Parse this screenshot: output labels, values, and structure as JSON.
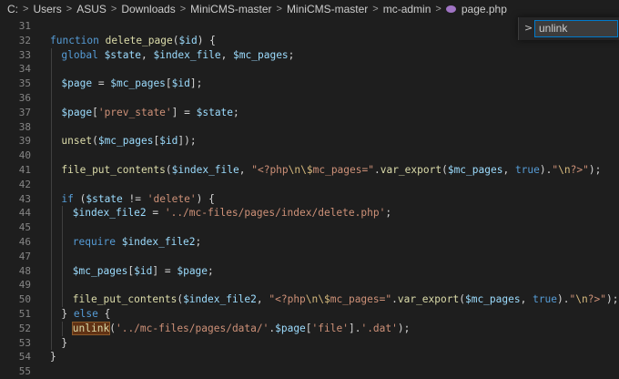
{
  "breadcrumb": {
    "items": [
      "C:",
      "Users",
      "ASUS",
      "Downloads",
      "MiniCMS-master",
      "MiniCMS-master",
      "mc-admin"
    ],
    "file": "page.php",
    "separator": ">"
  },
  "find_widget": {
    "toggle": ">",
    "value": "unlink"
  },
  "editor": {
    "lines": [
      {
        "n": "31",
        "indent": 0,
        "t": []
      },
      {
        "n": "32",
        "indent": 0,
        "t": [
          [
            "kw",
            "function"
          ],
          [
            "p",
            " "
          ],
          [
            "fn",
            "delete_page"
          ],
          [
            "p",
            "("
          ],
          [
            "var",
            "$id"
          ],
          [
            "p",
            ") {"
          ]
        ]
      },
      {
        "n": "33",
        "indent": 1,
        "t": [
          [
            "kw",
            "global"
          ],
          [
            "p",
            " "
          ],
          [
            "var",
            "$state"
          ],
          [
            "p",
            ", "
          ],
          [
            "var",
            "$index_file"
          ],
          [
            "p",
            ", "
          ],
          [
            "var",
            "$mc_pages"
          ],
          [
            "p",
            ";"
          ]
        ]
      },
      {
        "n": "34",
        "indent": 1,
        "t": []
      },
      {
        "n": "35",
        "indent": 1,
        "t": [
          [
            "var",
            "$page"
          ],
          [
            "p",
            " = "
          ],
          [
            "var",
            "$mc_pages"
          ],
          [
            "p",
            "["
          ],
          [
            "var",
            "$id"
          ],
          [
            "p",
            "];"
          ]
        ]
      },
      {
        "n": "36",
        "indent": 1,
        "t": []
      },
      {
        "n": "37",
        "indent": 1,
        "t": [
          [
            "var",
            "$page"
          ],
          [
            "p",
            "["
          ],
          [
            "str",
            "'prev_state'"
          ],
          [
            "p",
            "] = "
          ],
          [
            "var",
            "$state"
          ],
          [
            "p",
            ";"
          ]
        ]
      },
      {
        "n": "38",
        "indent": 1,
        "t": []
      },
      {
        "n": "39",
        "indent": 1,
        "t": [
          [
            "fn",
            "unset"
          ],
          [
            "p",
            "("
          ],
          [
            "var",
            "$mc_pages"
          ],
          [
            "p",
            "["
          ],
          [
            "var",
            "$id"
          ],
          [
            "p",
            "]);"
          ]
        ]
      },
      {
        "n": "40",
        "indent": 1,
        "t": []
      },
      {
        "n": "41",
        "indent": 1,
        "t": [
          [
            "fn",
            "file_put_contents"
          ],
          [
            "p",
            "("
          ],
          [
            "var",
            "$index_file"
          ],
          [
            "p",
            ", "
          ],
          [
            "str",
            "\"<?php"
          ],
          [
            "esc",
            "\\n\\$"
          ],
          [
            "str",
            "mc_pages=\""
          ],
          [
            "p",
            "."
          ],
          [
            "fn",
            "var_export"
          ],
          [
            "p",
            "("
          ],
          [
            "var",
            "$mc_pages"
          ],
          [
            "p",
            ", "
          ],
          [
            "kw",
            "true"
          ],
          [
            "p",
            ")."
          ],
          [
            "str",
            "\""
          ],
          [
            "esc",
            "\\n"
          ],
          [
            "str",
            "?>\""
          ],
          [
            "p",
            ");"
          ]
        ]
      },
      {
        "n": "42",
        "indent": 1,
        "t": []
      },
      {
        "n": "43",
        "indent": 1,
        "t": [
          [
            "kw",
            "if"
          ],
          [
            "p",
            " ("
          ],
          [
            "var",
            "$state"
          ],
          [
            "p",
            " != "
          ],
          [
            "str",
            "'delete'"
          ],
          [
            "p",
            ") {"
          ]
        ]
      },
      {
        "n": "44",
        "indent": 2,
        "t": [
          [
            "var",
            "$index_file2"
          ],
          [
            "p",
            " = "
          ],
          [
            "str",
            "'../mc-files/pages/index/delete.php'"
          ],
          [
            "p",
            ";"
          ]
        ]
      },
      {
        "n": "45",
        "indent": 2,
        "t": []
      },
      {
        "n": "46",
        "indent": 2,
        "t": [
          [
            "kw",
            "require"
          ],
          [
            "p",
            " "
          ],
          [
            "var",
            "$index_file2"
          ],
          [
            "p",
            ";"
          ]
        ]
      },
      {
        "n": "47",
        "indent": 2,
        "t": []
      },
      {
        "n": "48",
        "indent": 2,
        "t": [
          [
            "var",
            "$mc_pages"
          ],
          [
            "p",
            "["
          ],
          [
            "var",
            "$id"
          ],
          [
            "p",
            "] = "
          ],
          [
            "var",
            "$page"
          ],
          [
            "p",
            ";"
          ]
        ]
      },
      {
        "n": "49",
        "indent": 2,
        "t": []
      },
      {
        "n": "50",
        "indent": 2,
        "t": [
          [
            "fn",
            "file_put_contents"
          ],
          [
            "p",
            "("
          ],
          [
            "var",
            "$index_file2"
          ],
          [
            "p",
            ", "
          ],
          [
            "str",
            "\"<?php"
          ],
          [
            "esc",
            "\\n\\$"
          ],
          [
            "str",
            "mc_pages=\""
          ],
          [
            "p",
            "."
          ],
          [
            "fn",
            "var_export"
          ],
          [
            "p",
            "("
          ],
          [
            "var",
            "$mc_pages"
          ],
          [
            "p",
            ", "
          ],
          [
            "kw",
            "true"
          ],
          [
            "p",
            ")."
          ],
          [
            "str",
            "\""
          ],
          [
            "esc",
            "\\n"
          ],
          [
            "str",
            "?>\""
          ],
          [
            "p",
            ");"
          ]
        ]
      },
      {
        "n": "51",
        "indent": 1,
        "t": [
          [
            "p",
            "} "
          ],
          [
            "kw",
            "else"
          ],
          [
            "p",
            " {"
          ]
        ]
      },
      {
        "n": "52",
        "indent": 2,
        "t": [
          [
            "hl",
            "unlink"
          ],
          [
            "p",
            "("
          ],
          [
            "str",
            "'../mc-files/pages/data/'"
          ],
          [
            "p",
            "."
          ],
          [
            "var",
            "$page"
          ],
          [
            "p",
            "["
          ],
          [
            "str",
            "'file'"
          ],
          [
            "p",
            "]."
          ],
          [
            "str",
            "'.dat'"
          ],
          [
            "p",
            ");"
          ]
        ]
      },
      {
        "n": "53",
        "indent": 1,
        "t": [
          [
            "p",
            "}"
          ]
        ]
      },
      {
        "n": "54",
        "indent": 0,
        "t": [
          [
            "p",
            "}"
          ]
        ]
      },
      {
        "n": "55",
        "indent": 0,
        "t": []
      }
    ]
  },
  "colors": {
    "background": "#1e1e1e",
    "keyword": "#569cd6",
    "function": "#dcdcaa",
    "variable": "#9cdcfe",
    "string": "#ce9178",
    "escape": "#d7ba7d",
    "line_number": "#858585",
    "find_border": "#007acc"
  }
}
